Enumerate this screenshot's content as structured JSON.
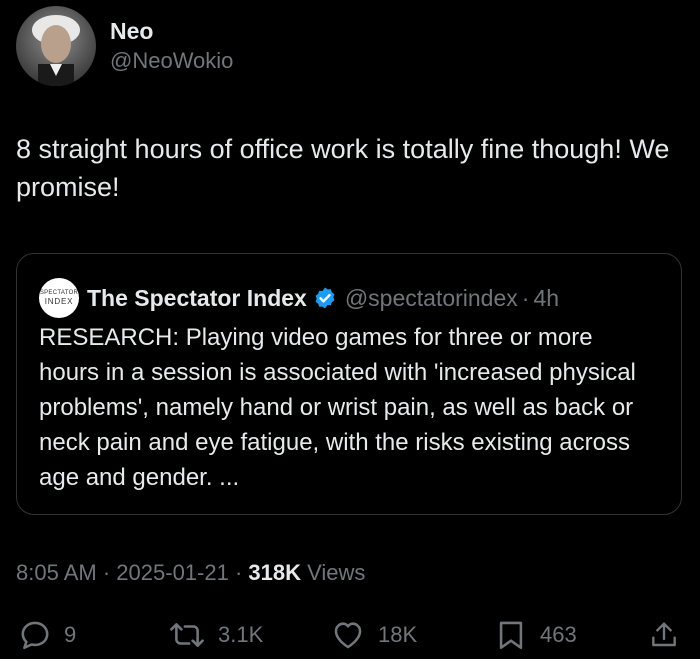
{
  "author": {
    "display_name": "Neo",
    "handle": "@NeoWokio"
  },
  "tweet": {
    "text": "8 straight hours of office work is totally fine though! We promise!"
  },
  "quoted_tweet": {
    "logo_text_top": "SPECTATOR",
    "logo_text_bottom": "INDEX",
    "display_name": "The Spectator Index",
    "handle": "@spectatorindex",
    "separator": "·",
    "time": "4h",
    "text": "RESEARCH: Playing video games for three or more hours in a session is associated with 'increased physical problems', namely hand or wrist pain, as well as back or neck pain and eye fatigue, with the risks existing across age and gender. ..."
  },
  "meta": {
    "time": "8:05 AM",
    "separator": "·",
    "date": "2025-01-21",
    "views_count": "318K",
    "views_label": "Views"
  },
  "actions": {
    "replies": "9",
    "reposts": "3.1K",
    "likes": "18K",
    "bookmarks": "463"
  },
  "colors": {
    "background": "#000000",
    "primary_text": "#e7e9ea",
    "secondary_text": "#71767b",
    "border": "#2f3336",
    "verified": "#1d9bf0"
  }
}
